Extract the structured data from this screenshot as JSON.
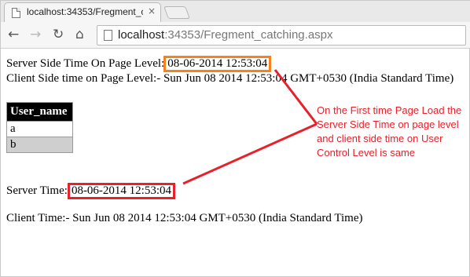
{
  "browser": {
    "tab": {
      "title": "localhost:34353/Fregment_catching.aspx",
      "close_glyph": "×"
    },
    "nav": {
      "back": "←",
      "forward": "→",
      "reload": "↻",
      "home": "⌂"
    },
    "address": {
      "host": "localhost",
      "rest": ":34353/Fregment_catching.aspx"
    }
  },
  "page": {
    "server_time_label": "Server Side Time On Page Level:",
    "server_time_value": "08-06-2014 12:53:04",
    "client_time_line": "Client Side time on Page Level:- Sun Jun 08 2014 12:53:04 GMT+0530 (India Standard Time)",
    "grid": {
      "header": "User_name",
      "rows": [
        "a",
        "b"
      ]
    },
    "control_server_label": "Server Time:",
    "control_server_value": "08-06-2014 12:53:04",
    "control_client_line": "Client Time:- Sun Jun 08 2014 12:53:04 GMT+0530 (India Standard Time)"
  },
  "annotation": {
    "text": "On the First time Page Load the Server Side Time on page level and client side time on User Control Level is same",
    "color": "#e8202a"
  },
  "colors": {
    "highlight_orange": "#f5821f",
    "highlight_red": "#e8202a",
    "grid_header_bg": "#000000",
    "grid_alt_row_bg": "#cfcfcf"
  }
}
